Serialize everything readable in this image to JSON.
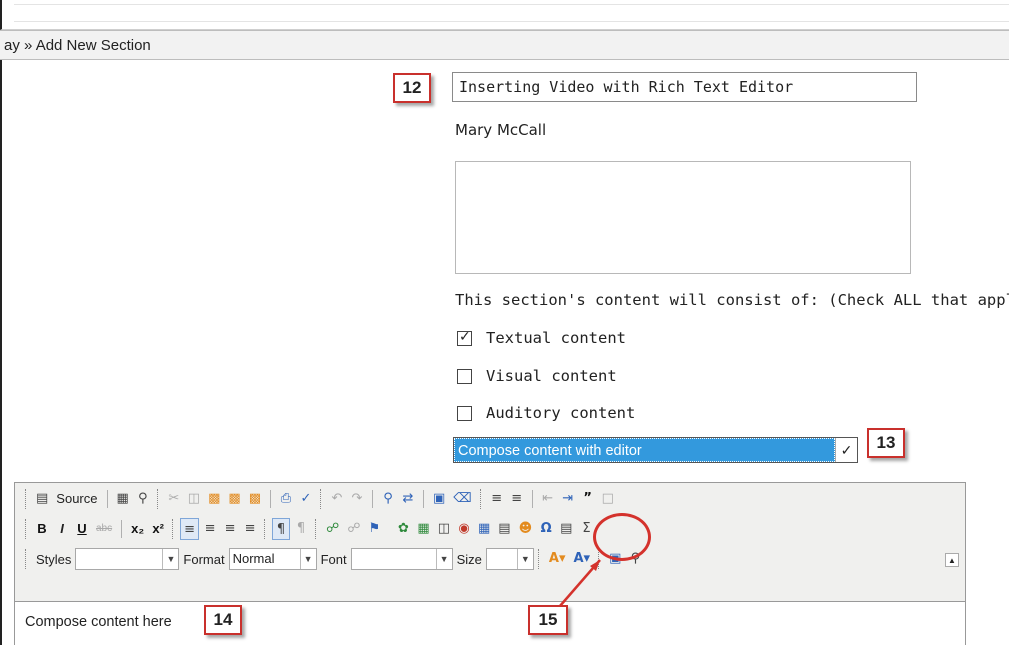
{
  "breadcrumb": "ay » Add New Section",
  "form": {
    "title_value": "Inserting Video with Rich Text Editor",
    "author": "Mary McCall",
    "consist_label": "This section's content will consist of: (Check ALL that apply)",
    "checkboxes": [
      {
        "label": "Textual content",
        "checked": true
      },
      {
        "label": "Visual content",
        "checked": false
      },
      {
        "label": "Auditory content",
        "checked": false
      }
    ],
    "mode_select": "Compose content with editor"
  },
  "callouts": {
    "c12": "12",
    "c13": "13",
    "c14": "14",
    "c15": "15"
  },
  "toolbar": {
    "source_label": "Source",
    "styles_label": "Styles",
    "format_label": "Format",
    "format_value": "Normal",
    "font_label": "Font",
    "size_label": "Size"
  },
  "editor": {
    "content": "Compose content here"
  },
  "colors": {
    "callout_border": "#c9302c",
    "select_bg": "#3399dd",
    "highlight": "#d4322c"
  }
}
